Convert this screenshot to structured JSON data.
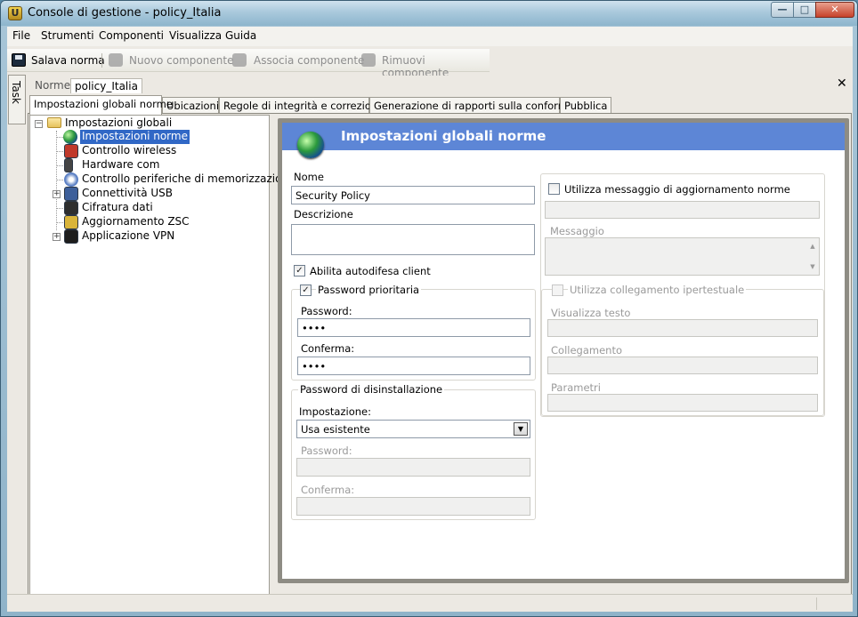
{
  "window": {
    "title": "Console di gestione  - policy_Italia",
    "app_icon_letter": "U"
  },
  "menu": [
    "File",
    "Strumenti",
    "Componenti",
    "Visualizza",
    "Guida"
  ],
  "toolbar": {
    "save": "Salava norma",
    "new_component": "Nuovo componente",
    "associate_component": "Associa componente",
    "remove_component": "Rimuovi componente"
  },
  "task_tab": "Task",
  "doc_tabs": [
    "Norme",
    "policy_Italia"
  ],
  "tabs": [
    "Impostazioni globali norme",
    "Ubicazioni",
    "Regole di integrità e correzione",
    "Generazione di rapporti sulla conformità",
    "Pubblica"
  ],
  "tree": {
    "root": "Impostazioni globali",
    "items": [
      "Impostazioni norme",
      "Controllo wireless",
      "Hardware com",
      "Controllo periferiche di memorizzazione",
      "Connettività USB",
      "Cifratura dati",
      "Aggiornamento ZSC",
      "Applicazione VPN"
    ]
  },
  "panel": {
    "title": "Impostazioni globali norme",
    "name_label": "Nome",
    "name_value": "Security Policy",
    "description_label": "Descrizione",
    "description_value": "",
    "self_defense": {
      "label": "Abilita autodifesa client",
      "checked": true
    },
    "override_password": {
      "label": "Password prioritaria",
      "checked": true,
      "password_label": "Password:",
      "password_value": "••••",
      "confirm_label": "Conferma:",
      "confirm_value": "••••"
    },
    "uninstall": {
      "title": "Password di disinstallazione",
      "setting_label": "Impostazione:",
      "setting_value": "Usa esistente",
      "password_label": "Password:",
      "confirm_label": "Conferma:"
    },
    "update_message": {
      "label": "Utilizza messaggio di aggiornamento norme",
      "checked": false,
      "message_label": "Messaggio"
    },
    "hyperlink": {
      "label": "Utilizza collegamento ipertestuale",
      "checked": false,
      "display_text_label": "Visualizza testo",
      "link_label": "Collegamento",
      "params_label": "Parametri"
    }
  }
}
